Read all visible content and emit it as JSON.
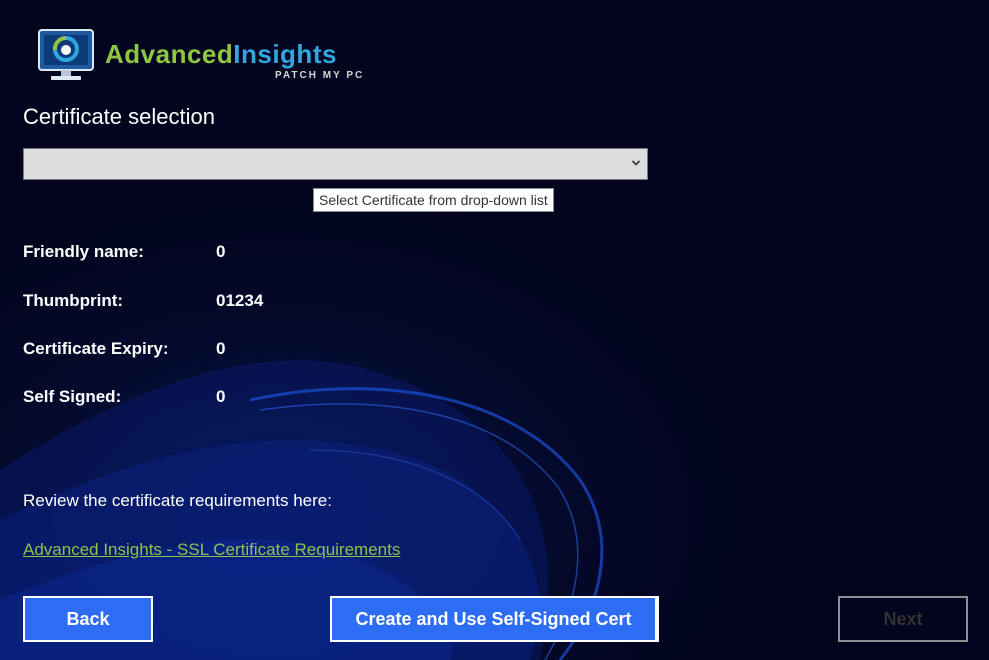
{
  "brand": {
    "word1": "Advanced",
    "word2": "Insights",
    "sub": "PATCH MY PC",
    "colors": {
      "green": "#8fc641",
      "blue": "#2fa7e0"
    }
  },
  "page": {
    "heading": "Certificate selection"
  },
  "certificate_select": {
    "value": "",
    "tooltip": "Select Certificate from drop-down list"
  },
  "details": [
    {
      "label": "Friendly name:",
      "value": "0"
    },
    {
      "label": "Thumbprint:",
      "value": "01234"
    },
    {
      "label": "Certificate Expiry:",
      "value": "0"
    },
    {
      "label": "Self Signed:",
      "value": "0"
    }
  ],
  "requirements": {
    "text": "Review the certificate requirements here:",
    "link": "Advanced Insights - SSL Certificate Requirements"
  },
  "buttons": {
    "back": "Back",
    "create": "Create and Use Self-Signed Cert",
    "next": "Next"
  },
  "colors": {
    "background": "#03051e",
    "button": "#2d6cf5",
    "link": "#8bc34a"
  }
}
